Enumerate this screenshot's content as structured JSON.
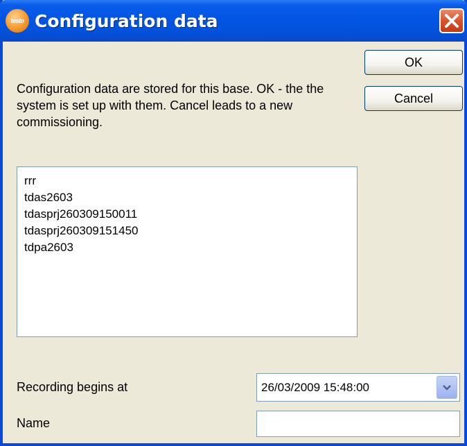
{
  "window": {
    "title": "Configuration data",
    "icon": "testo-logo-icon",
    "icon_text": "testo"
  },
  "buttons": {
    "ok_label": "OK",
    "cancel_label": "Cancel"
  },
  "message": "Configuration data are stored for this base. OK - the the system is set up with them. Cancel leads to a new commissioning.",
  "list": {
    "items": [
      "rrr",
      "tdas2603",
      "tdasprj260309150011",
      "tdasprj260309151450",
      "tdpa2603"
    ]
  },
  "recording": {
    "label": "Recording begins at",
    "value": "26/03/2009 15:48:00"
  },
  "name_field": {
    "label": "Name",
    "value": ""
  },
  "colors": {
    "titlebar": "#0356e4",
    "close": "#d8532c",
    "background": "#ece9d8"
  }
}
